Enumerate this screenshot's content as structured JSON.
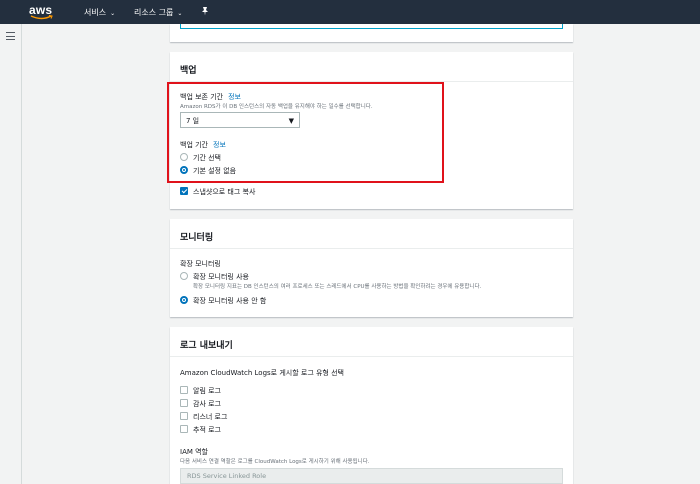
{
  "nav": {
    "logo": "aws",
    "services": "서비스",
    "resource_groups": "리소스 그룹",
    "chevron": "⌄"
  },
  "backup": {
    "title": "백업",
    "retention_label": "백업 보존 기간",
    "info": "정보",
    "retention_desc": "Amazon RDS가 이 DB 인스턴스의 자동 백업을 유지해야 하는 일수를 선택합니다.",
    "retention_value": "7 일",
    "window_label": "백업 기간",
    "window_options": [
      "기간 선택",
      "기본 설정 없음"
    ],
    "window_selected": "기본 설정 없음",
    "copy_tags_label": "스냅샷으로 태그 복사",
    "copy_tags_checked": true
  },
  "monitoring": {
    "title": "모니터링",
    "enhanced_label": "확장 모니터링",
    "enable_option": "확장 모니터링 사용",
    "enable_desc": "확장 모니터링 지표는 DB 인스턴스의 여러 프로세스 또는 스레드에서 CPU를 사용하는 방법을 확인하려는 경우에 유용합니다.",
    "disable_option": "확장 모니터링 사용 안 함",
    "selected": "확장 모니터링 사용 안 함"
  },
  "logs": {
    "title": "로그 내보내기",
    "select_label": "Amazon CloudWatch Logs로 게시할 로그 유형 선택",
    "types": [
      "알림 로그",
      "감사 로그",
      "리스너 로그",
      "추적 로그"
    ],
    "iam_label": "IAM 역할",
    "iam_desc": "다음 서비스 연결 역할은 로그를 CloudWatch Logs로 게시하기 위해 사용됩니다.",
    "iam_value": "RDS Service Linked Role"
  },
  "colors": {
    "nav_bg": "#232f3e",
    "accent": "#0073bb",
    "highlight": "#e0121b"
  }
}
